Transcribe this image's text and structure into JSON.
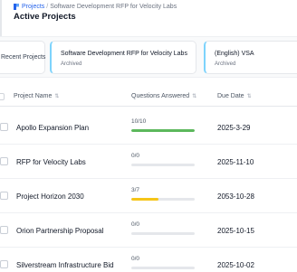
{
  "breadcrumb": {
    "root": "Projects",
    "separator": "/",
    "current": "Software Development RFP for Velocity Labs"
  },
  "page_title": "Active Projects",
  "recent_cards": {
    "label": "Recent Projects",
    "items": [
      {
        "title": "Software Development RFP for Velocity Labs",
        "status": "Archived"
      },
      {
        "title": "(English) VSA",
        "status": "Archived"
      }
    ]
  },
  "table": {
    "headers": {
      "name": "Project Name",
      "questions": "Questions Answered",
      "due": "Due Date"
    },
    "rows": [
      {
        "name": "Apollo Expansion Plan",
        "answered": "10/10",
        "progress": 1.0,
        "color": "#5cb85c",
        "due": "2025-3-29"
      },
      {
        "name": "RFP for Velocity Labs",
        "answered": "0/0",
        "progress": 0.0,
        "color": "#e5e7eb",
        "due": "2025-11-10"
      },
      {
        "name": "Project Horizon 2030",
        "answered": "3/7",
        "progress": 0.43,
        "color": "#f5c518",
        "due": "2053-10-28"
      },
      {
        "name": "Orion Partnership Proposal",
        "answered": "0/0",
        "progress": 0.0,
        "color": "#e5e7eb",
        "due": "2025-10-15"
      },
      {
        "name": "Silverstream Infrastructure Bid",
        "answered": "0/0",
        "progress": 0.0,
        "color": "#e5e7eb",
        "due": "2025-10-02"
      }
    ]
  },
  "colors": {
    "link": "#2563eb",
    "card_accent": "#7dd3fc",
    "complete": "#5cb85c",
    "partial": "#f5c518"
  }
}
